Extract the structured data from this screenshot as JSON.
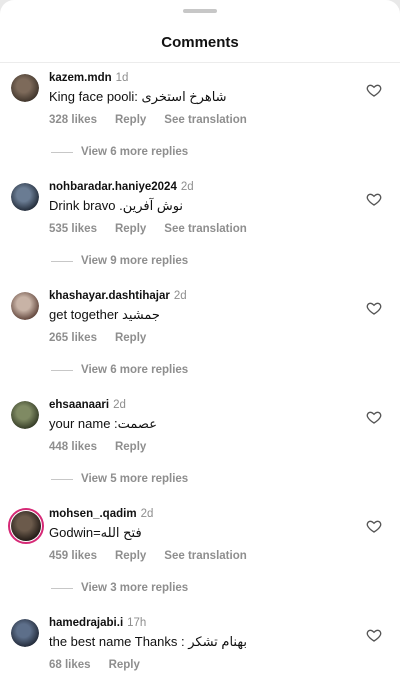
{
  "header": {
    "title": "Comments"
  },
  "comments": [
    {
      "username": "kazem.mdn",
      "time": "1d",
      "text": "King face pooli: شاهرخ استخری",
      "likes": "328 likes",
      "reply": "Reply",
      "translate": "See translation",
      "more_replies": "View 6 more replies",
      "avatar_colors": [
        "#7d6a5a",
        "#3a3027"
      ]
    },
    {
      "username": "nohbaradar.haniye2024",
      "time": "2d",
      "text": "Drink bravo .نوش آفرین",
      "likes": "535 likes",
      "reply": "Reply",
      "translate": "See translation",
      "more_replies": "View 9 more replies",
      "avatar_colors": [
        "#6a7c93",
        "#1d2633"
      ]
    },
    {
      "username": "khashayar.dashtihajar",
      "time": "2d",
      "text": "get together جمشید",
      "likes": "265 likes",
      "reply": "Reply",
      "translate": "",
      "more_replies": "View 6 more replies",
      "avatar_colors": [
        "#c8b3a6",
        "#5b3f35"
      ]
    },
    {
      "username": "ehsaanaari",
      "time": "2d",
      "text": "your name :عصمت",
      "likes": "448 likes",
      "reply": "Reply",
      "translate": "",
      "more_replies": "View 5 more replies",
      "avatar_colors": [
        "#7f8a63",
        "#2f3622"
      ]
    },
    {
      "username": "mohsen_.qadim",
      "time": "2d",
      "text": "Godwin=فتح الله",
      "likes": "459 likes",
      "reply": "Reply",
      "translate": "See translation",
      "more_replies": "View 3 more replies",
      "avatar_colors": [
        "#6b5a4b",
        "#1c1612"
      ]
    },
    {
      "username": "hamedrajabi.i",
      "time": "17h",
      "text": "the best name Thanks : بهنام تشکر",
      "likes": "68 likes",
      "reply": "Reply",
      "translate": "",
      "more_replies": "",
      "avatar_colors": [
        "#5d6f8a",
        "#1e2533"
      ]
    }
  ]
}
